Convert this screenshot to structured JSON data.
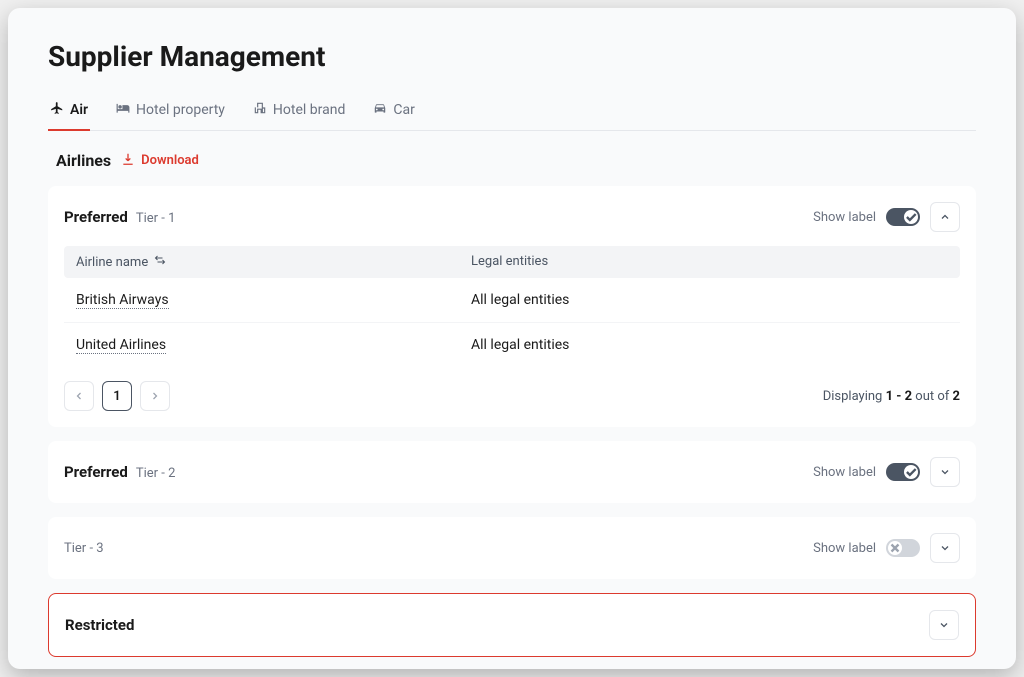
{
  "page_title": "Supplier Management",
  "tabs": [
    {
      "label": "Air",
      "active": true
    },
    {
      "label": "Hotel property",
      "active": false
    },
    {
      "label": "Hotel brand",
      "active": false
    },
    {
      "label": "Car",
      "active": false
    }
  ],
  "section": {
    "title": "Airlines",
    "download_label": "Download"
  },
  "tiers": [
    {
      "name": "Preferred",
      "tier_label": "Tier - 1",
      "show_label_text": "Show label",
      "toggle_on": true,
      "expanded": true,
      "table": {
        "columns": {
          "name": "Airline name",
          "legal": "Legal entities"
        },
        "rows": [
          {
            "name": "British Airways",
            "legal": "All legal entities"
          },
          {
            "name": "United Airlines",
            "legal": "All legal entities"
          }
        ],
        "pagination": {
          "current_page": "1",
          "display_prefix": "Displaying ",
          "range": "1 - 2",
          "out_of_text": " out of ",
          "total": "2"
        }
      }
    },
    {
      "name": "Preferred",
      "tier_label": "Tier - 2",
      "show_label_text": "Show label",
      "toggle_on": true,
      "expanded": false
    },
    {
      "name": "",
      "tier_label": "Tier - 3",
      "show_label_text": "Show label",
      "toggle_on": false,
      "expanded": false
    }
  ],
  "restricted": {
    "name": "Restricted"
  }
}
